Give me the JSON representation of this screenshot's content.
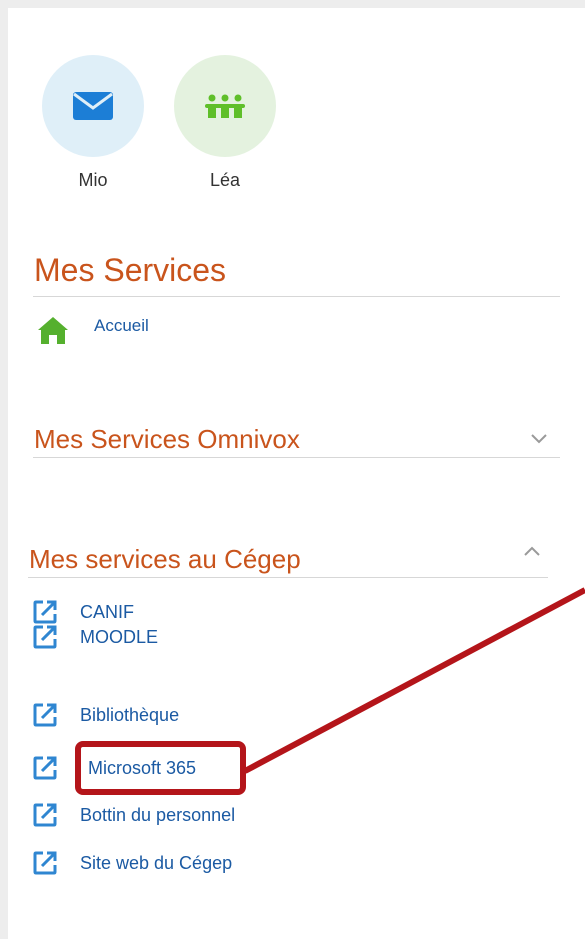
{
  "apps": [
    {
      "label": "Mio",
      "icon": "envelope-icon",
      "bg": "#dfeff8",
      "color": "#1c7ed6"
    },
    {
      "label": "Léa",
      "icon": "people-group-icon",
      "bg": "#e4f2df",
      "color": "#5fbf2a"
    }
  ],
  "services": {
    "title": "Mes Services",
    "home": {
      "label": "Accueil",
      "icon": "home-icon",
      "color": "#55b02e"
    }
  },
  "omnivox": {
    "title": "Mes Services Omnivox",
    "state_icon": "chevron-down-icon"
  },
  "cegep": {
    "title": "Mes services au Cégep",
    "state_icon": "chevron-up-icon",
    "items": [
      {
        "label": "CANIF",
        "icon": "external-link-icon"
      },
      {
        "label": "MOODLE",
        "icon": "external-link-icon"
      },
      {
        "label": "Bibliothèque",
        "icon": "external-link-icon"
      },
      {
        "label": "Microsoft 365",
        "icon": "external-link-icon"
      },
      {
        "label": "Bottin du personnel",
        "icon": "external-link-icon"
      },
      {
        "label": "Site web du Cégep",
        "icon": "external-link-icon"
      }
    ]
  },
  "colors": {
    "accent": "#c9541c",
    "link": "#1b5aa3",
    "icon_blue": "#2f86d1",
    "highlight": "#b4151a"
  }
}
